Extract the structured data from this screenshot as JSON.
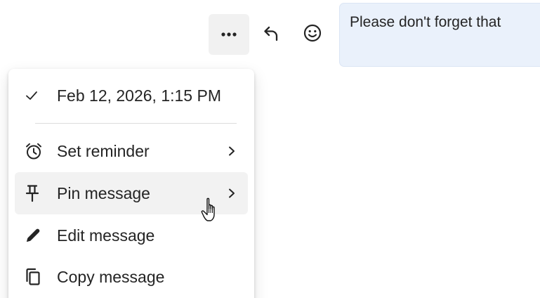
{
  "message": {
    "text": "Please don't forget that"
  },
  "actions": {
    "more_icon": "more-horizontal-icon",
    "reply_icon": "reply-arrow-icon",
    "react_icon": "smiley-icon"
  },
  "menu": {
    "timestamp": "Feb 12, 2026, 1:15 PM",
    "items": [
      {
        "label": "Set reminder",
        "icon": "alarm-clock-icon",
        "has_submenu": true
      },
      {
        "label": "Pin message",
        "icon": "pin-icon",
        "has_submenu": true,
        "hovered": true
      },
      {
        "label": "Edit message",
        "icon": "pencil-icon",
        "has_submenu": false
      },
      {
        "label": "Copy message",
        "icon": "copy-icon",
        "has_submenu": false
      }
    ]
  },
  "colors": {
    "bubble_bg": "#eaf1fb",
    "hover_bg": "#f2f2f2",
    "text": "#242424"
  }
}
